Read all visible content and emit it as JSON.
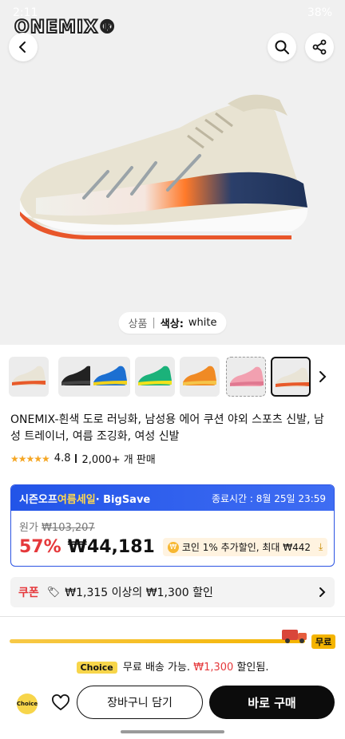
{
  "status_bar": {
    "time": "2:11",
    "battery": "38%"
  },
  "brand": {
    "logo_text": "ONEMIX®"
  },
  "image": {
    "pill_label": "상품",
    "pill_color_label": "색상:",
    "pill_color_value": "white"
  },
  "thumbnails": [
    {
      "color": "#e9e4d6",
      "accent": "#e85a2a"
    },
    {
      "color": "#222222",
      "accent": "#444444"
    },
    {
      "color": "#1c6fd1",
      "accent": "#f2d21b"
    },
    {
      "color": "#1bb27a",
      "accent": "#f2e21b"
    },
    {
      "color": "#f08a24",
      "accent": "#f5c54a"
    },
    {
      "color": "#f2a0b0",
      "accent": "#e07890"
    },
    {
      "color": "#e9e4d6",
      "accent": "#e85a2a"
    }
  ],
  "product": {
    "title": "ONEMIX-흰색 도로 러닝화, 남성용 에어 쿠션 야외 스포츠 신발, 남성 트레이너, 여름 조깅화, 여성 신발",
    "rating": "4.8",
    "sold": "2,000+ 개 판매"
  },
  "sale": {
    "event_name_a": "시즌오프",
    "event_name_b": "여름세일",
    "event_name_c": "· BigSave",
    "end_label": "종료시간 :",
    "end_time": "8월 25일 23:59",
    "original_label": "원가",
    "original_price": "₩103,207",
    "discount": "57%",
    "price": "₩44,181",
    "coin_text": "코인 1% 추가할인, 최대 ₩442"
  },
  "coupon": {
    "label": "쿠폰",
    "text": "₩1,315 이상의 ₩1,300 할인"
  },
  "shipping": {
    "free_badge": "무료",
    "choice_badge": "Choice",
    "msg_a": "무료 배송 가능.",
    "msg_amount": "₩1,300",
    "msg_b": "할인됨."
  },
  "actions": {
    "choice_label": "Choice",
    "cart": "장바구니 담기",
    "buy": "바로 구매"
  }
}
